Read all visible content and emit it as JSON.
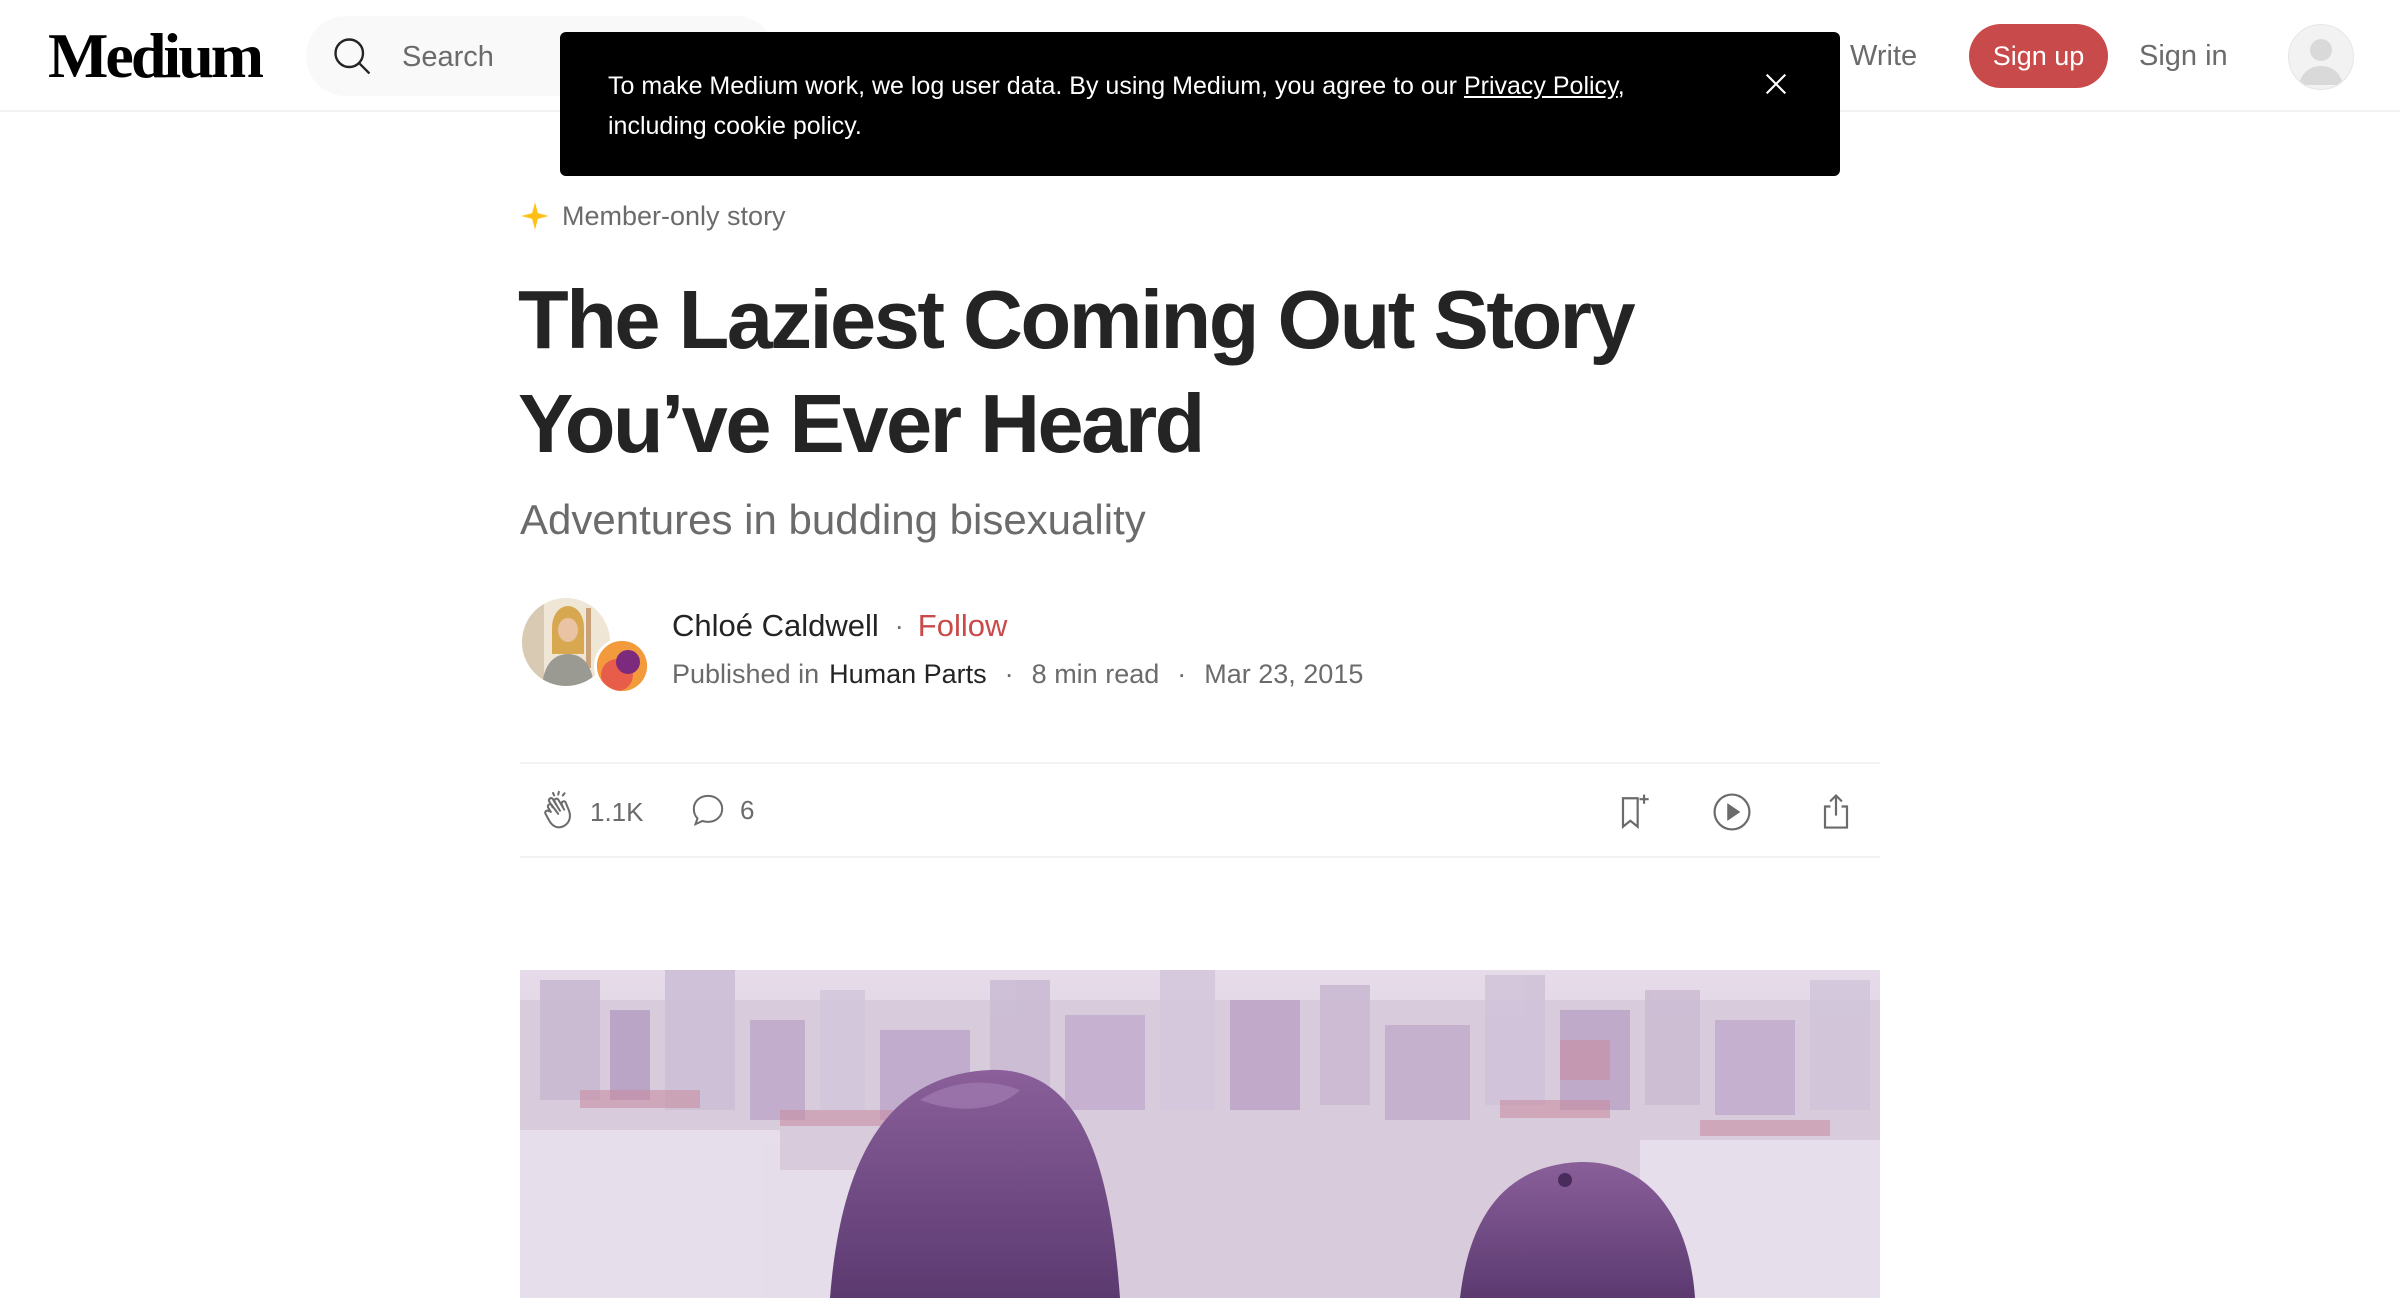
{
  "header": {
    "logo": "Medium",
    "search_placeholder": "Search",
    "write_label": "Write",
    "signup_label": "Sign up",
    "signin_label": "Sign in"
  },
  "cookie_banner": {
    "text_before": "To make Medium work, we log user data. By using Medium, you agree to our ",
    "link_text": "Privacy Policy",
    "text_after": ", including cookie policy."
  },
  "article": {
    "member_label": "Member-only story",
    "title": "The Laziest Coming Out Story You’ve Ever Heard",
    "subtitle": "Adventures in budding bisexuality",
    "author": "Chloé Caldwell",
    "dot": "·",
    "follow_label": "Follow",
    "published_in": "Published in",
    "publication": "Human Parts",
    "read_time": "8 min read",
    "date": "Mar 23, 2015"
  },
  "actions": {
    "claps": "1.1K",
    "responses": "6"
  },
  "colors": {
    "accent": "#c94a4a",
    "member_star": "#ffc017",
    "text": "#242424",
    "muted": "#6b6b6b"
  },
  "icons": [
    "search-icon",
    "write-icon",
    "user-avatar-icon",
    "close-icon",
    "star-icon",
    "clap-icon",
    "response-icon",
    "bookmark-icon",
    "play-icon",
    "share-icon"
  ]
}
